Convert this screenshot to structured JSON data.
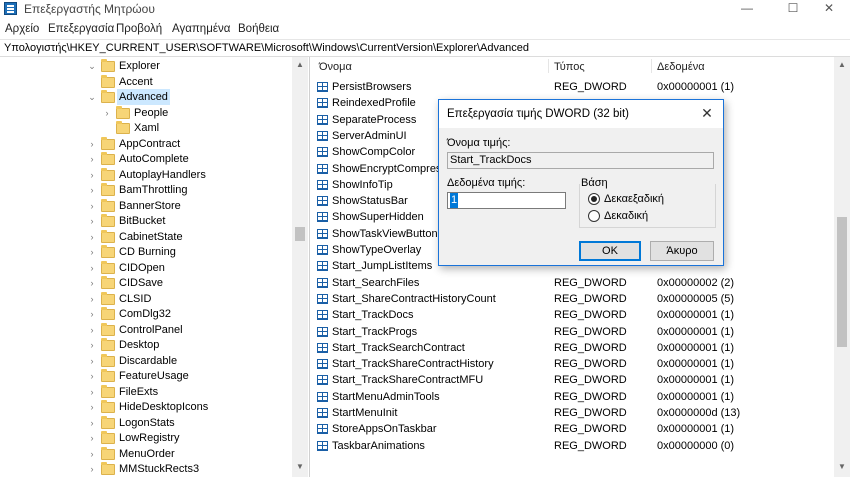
{
  "window": {
    "title": "Επεξεργαστής Μητρώου",
    "minimize": "—",
    "maximize": "☐",
    "close": "✕"
  },
  "menu": [
    "Αρχείο",
    "Επεξεργασία",
    "Προβολή",
    "Αγαπημένα",
    "Βοήθεια"
  ],
  "address": "Υπολογιστής\\HKEY_CURRENT_USER\\SOFTWARE\\Microsoft\\Windows\\CurrentVersion\\Explorer\\Advanced",
  "tree": [
    {
      "label": "Explorer",
      "chevron": "⌄"
    },
    {
      "label": "Accent",
      "chevron": ""
    },
    {
      "label": "Advanced",
      "chevron": "⌄",
      "selected": true
    },
    {
      "label": "People",
      "chevron": "›"
    },
    {
      "label": "Xaml",
      "chevron": ""
    },
    {
      "label": "AppContract",
      "chevron": "›"
    },
    {
      "label": "AutoComplete",
      "chevron": "›"
    },
    {
      "label": "AutoplayHandlers",
      "chevron": "›"
    },
    {
      "label": "BamThrottling",
      "chevron": "›"
    },
    {
      "label": "BannerStore",
      "chevron": "›"
    },
    {
      "label": "BitBucket",
      "chevron": "›"
    },
    {
      "label": "CabinetState",
      "chevron": "›"
    },
    {
      "label": "CD Burning",
      "chevron": "›"
    },
    {
      "label": "CIDOpen",
      "chevron": "›"
    },
    {
      "label": "CIDSave",
      "chevron": "›"
    },
    {
      "label": "CLSID",
      "chevron": "›"
    },
    {
      "label": "ComDlg32",
      "chevron": "›"
    },
    {
      "label": "ControlPanel",
      "chevron": "›"
    },
    {
      "label": "Desktop",
      "chevron": "›"
    },
    {
      "label": "Discardable",
      "chevron": "›"
    },
    {
      "label": "FeatureUsage",
      "chevron": "›"
    },
    {
      "label": "FileExts",
      "chevron": "›"
    },
    {
      "label": "HideDesktopIcons",
      "chevron": "›"
    },
    {
      "label": "LogonStats",
      "chevron": "›"
    },
    {
      "label": "LowRegistry",
      "chevron": "›"
    },
    {
      "label": "MenuOrder",
      "chevron": "›"
    },
    {
      "label": "MMStuckRects3",
      "chevron": "›"
    }
  ],
  "list": {
    "columns": {
      "name": "Όνομα",
      "type": "Τύπος",
      "data": "Δεδομένα"
    },
    "rows": [
      {
        "name": "PersistBrowsers",
        "type": "REG_DWORD",
        "data": "0x00000001 (1)"
      },
      {
        "name": "ReindexedProfile",
        "type": "",
        "data": ""
      },
      {
        "name": "SeparateProcess",
        "type": "",
        "data": ""
      },
      {
        "name": "ServerAdminUI",
        "type": "",
        "data": ""
      },
      {
        "name": "ShowCompColor",
        "type": "",
        "data": ""
      },
      {
        "name": "ShowEncryptCompress",
        "type": "",
        "data": ""
      },
      {
        "name": "ShowInfoTip",
        "type": "",
        "data": ""
      },
      {
        "name": "ShowStatusBar",
        "type": "",
        "data": ""
      },
      {
        "name": "ShowSuperHidden",
        "type": "",
        "data": ""
      },
      {
        "name": "ShowTaskViewButton",
        "type": "",
        "data": ""
      },
      {
        "name": "ShowTypeOverlay",
        "type": "",
        "data": ""
      },
      {
        "name": "Start_JumpListItems",
        "type": "",
        "data": ""
      },
      {
        "name": "Start_SearchFiles",
        "type": "REG_DWORD",
        "data": "0x00000002 (2)"
      },
      {
        "name": "Start_ShareContractHistoryCount",
        "type": "REG_DWORD",
        "data": "0x00000005 (5)"
      },
      {
        "name": "Start_TrackDocs",
        "type": "REG_DWORD",
        "data": "0x00000001 (1)"
      },
      {
        "name": "Start_TrackProgs",
        "type": "REG_DWORD",
        "data": "0x00000001 (1)"
      },
      {
        "name": "Start_TrackSearchContract",
        "type": "REG_DWORD",
        "data": "0x00000001 (1)"
      },
      {
        "name": "Start_TrackShareContractHistory",
        "type": "REG_DWORD",
        "data": "0x00000001 (1)"
      },
      {
        "name": "Start_TrackShareContractMFU",
        "type": "REG_DWORD",
        "data": "0x00000001 (1)"
      },
      {
        "name": "StartMenuAdminTools",
        "type": "REG_DWORD",
        "data": "0x00000001 (1)"
      },
      {
        "name": "StartMenuInit",
        "type": "REG_DWORD",
        "data": "0x0000000d (13)"
      },
      {
        "name": "StoreAppsOnTaskbar",
        "type": "REG_DWORD",
        "data": "0x00000001 (1)"
      },
      {
        "name": "TaskbarAnimations",
        "type": "REG_DWORD",
        "data": "0x00000000 (0)"
      }
    ]
  },
  "dialog": {
    "title": "Επεξεργασία τιμής DWORD (32 bit)",
    "close": "✕",
    "value_name_label": "Όνομα τιμής:",
    "value_name": "Start_TrackDocs",
    "value_data_label": "Δεδομένα τιμής:",
    "value_data": "1",
    "base_label": "Βάση",
    "hex_label": "Δεκαεξαδική",
    "dec_label": "Δεκαδική",
    "selected_base": "hex",
    "ok": "OK",
    "cancel": "Άκυρο"
  }
}
